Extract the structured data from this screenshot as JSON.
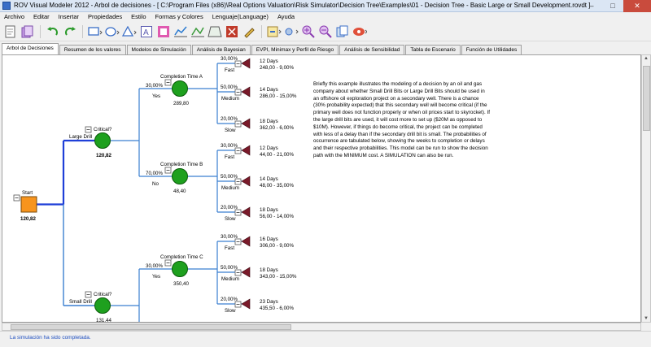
{
  "window": {
    "title": "ROV Visual Modeler 2012 - Arbol de decisiones - [ C:\\Program Files (x86)\\Real Options Valuation\\Risk Simulator\\Decision Tree\\Examples\\01 - Decision Tree - Basic Large or Small Development.rovdt ]",
    "minimize": "–",
    "maximize": "□",
    "close": "✕"
  },
  "menu": [
    "Archivo",
    "Editar",
    "Insertar",
    "Propiedades",
    "Estilo",
    "Formas y Colores",
    "Lenguaje(Language)",
    "Ayuda"
  ],
  "tabs": [
    "Arbol de Decisiones",
    "Resumen de los valores",
    "Modelos de Simulación",
    "Análisis de Bayesian",
    "EVPI, Minimax y Perfil de Riesgo",
    "Análisis de Sensibilidad",
    "Tabla de Escenario",
    "Función de Utilidades"
  ],
  "tree": {
    "root": {
      "label": "Start",
      "value": "120,82"
    },
    "decisions": [
      {
        "label": "Critical?",
        "value": "120,82",
        "branch": "Large Drill"
      },
      {
        "label": "Critical?",
        "value": "131,44",
        "branch": "Small Drill"
      }
    ],
    "chances": [
      {
        "label": "Completion Time A",
        "value": "289,80",
        "prob": "30,00%",
        "branch": "Yes"
      },
      {
        "label": "Completion Time B",
        "value": "48,40",
        "prob": "70,00%",
        "branch": "No"
      },
      {
        "label": "Completion Time C",
        "value": "350,40",
        "prob": "30,00%",
        "branch": "Yes"
      }
    ],
    "outcomes": [
      {
        "prob": "30,00%",
        "branch": "Fast",
        "days": "12 Days",
        "value": "248,00 - 9,00%"
      },
      {
        "prob": "50,00%",
        "branch": "Medium",
        "days": "14 Days",
        "value": "286,00 - 15,00%"
      },
      {
        "prob": "20,00%",
        "branch": "Slow",
        "days": "18 Days",
        "value": "362,00 - 6,00%"
      },
      {
        "prob": "30,00%",
        "branch": "Fast",
        "days": "12 Days",
        "value": "44,00 - 21,00%"
      },
      {
        "prob": "50,00%",
        "branch": "Medium",
        "days": "14 Days",
        "value": "48,00 - 35,00%"
      },
      {
        "prob": "20,00%",
        "branch": "Slow",
        "days": "18 Days",
        "value": "56,00 - 14,00%"
      },
      {
        "prob": "30,00%",
        "branch": "Fast",
        "days": "16 Days",
        "value": "306,00 - 9,00%"
      },
      {
        "prob": "50,00%",
        "branch": "Medium",
        "days": "18 Days",
        "value": "343,00 - 15,00%"
      },
      {
        "prob": "20,00%",
        "branch": "Slow",
        "days": "23 Days",
        "value": "435,50 - 6,00%"
      }
    ]
  },
  "description": "Briefly this example illustrates the modeling of a decision by an oil and gas company about whether Small Drill Bits or Large Drill Bits should be used in an offshore oil exploration project on a secondary well. There is a chance (30% probability expected) that this secondary well will become critical (if the primary well does not function properly or when oil prices start to skyrocket). If the large drill bits are used, it will cost more to set up ($20M as opposed to $10M). However, if things do become critical, the project can be completed with less of a delay than if the secondary drill bit is small. The probabilities of occurrence are tabulated below, showing the weeks to completion or delays and their respective probabilities. This model can be run to show the decision path with the MINIMUM cost. A SIMULATION can also be run.",
  "status": "La simulación ha sido completada.",
  "toolbar_icons": [
    "new-icon",
    "open-icon",
    "undo-icon",
    "redo-icon",
    "rectangle-icon",
    "ellipse-icon",
    "triangle-icon",
    "text-icon",
    "square-node-icon",
    "chart-icon",
    "inspect-icon",
    "triangle-node-icon",
    "delete-icon",
    "pencil-icon",
    "run-icon",
    "zoom-in-icon",
    "zoom-out-icon",
    "copy-icon",
    "link-icon"
  ],
  "colors": {
    "decision_fill": "#f7941d",
    "chance_fill": "#1ea01e",
    "terminal_fill": "#7a1a2a",
    "branch_line": "#3a7fd0",
    "highlight_path": "#1f3fd8"
  }
}
